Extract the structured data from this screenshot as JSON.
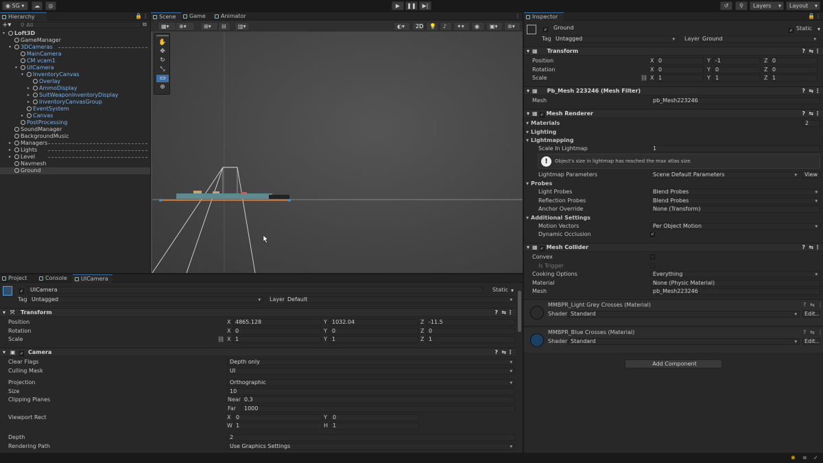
{
  "toolbar": {
    "account": "SG",
    "layers": "Layers",
    "layout": "Layout"
  },
  "hierarchy": {
    "tab": "Hierarchy",
    "search_placeholder": "All",
    "items": [
      {
        "label": "Loft3D",
        "depth": 0,
        "blue": false
      },
      {
        "label": "GameManager",
        "depth": 1,
        "blue": false
      },
      {
        "label": "3DCameras",
        "depth": 1,
        "blue": true
      },
      {
        "label": "MainCamera",
        "depth": 2,
        "blue": true
      },
      {
        "label": "CM vcam1",
        "depth": 2,
        "blue": true
      },
      {
        "label": "UICamera",
        "depth": 2,
        "blue": true
      },
      {
        "label": "InventoryCanvas",
        "depth": 3,
        "blue": true
      },
      {
        "label": "Overlay",
        "depth": 4,
        "blue": true
      },
      {
        "label": "AmmoDisplay",
        "depth": 4,
        "blue": true
      },
      {
        "label": "SuitWeaponInventoryDisplay",
        "depth": 4,
        "blue": true
      },
      {
        "label": "InventoryCanvasGroup",
        "depth": 4,
        "blue": true
      },
      {
        "label": "EventSystem",
        "depth": 3,
        "blue": true
      },
      {
        "label": "Canvas",
        "depth": 3,
        "blue": true
      },
      {
        "label": "PostProcessing",
        "depth": 2,
        "blue": true
      },
      {
        "label": "SoundManager",
        "depth": 1,
        "blue": false
      },
      {
        "label": "BackgroundMusic",
        "depth": 1,
        "blue": false
      },
      {
        "label": "Managers",
        "depth": 1,
        "blue": false
      },
      {
        "label": "Lights",
        "depth": 1,
        "blue": false
      },
      {
        "label": "Level",
        "depth": 1,
        "blue": false
      },
      {
        "label": "Navmesh",
        "depth": 1,
        "blue": false
      },
      {
        "label": "Ground",
        "depth": 1,
        "blue": false
      }
    ]
  },
  "scene": {
    "tabs": [
      "Scene",
      "Game",
      "Animator"
    ],
    "mode2d": "2D"
  },
  "bottom": {
    "tabs": [
      "Project",
      "Console",
      "UICamera"
    ],
    "object": {
      "name": "UICamera",
      "static": "Static",
      "tag_label": "Tag",
      "tag": "Untagged",
      "layer_label": "Layer",
      "layer": "Default"
    },
    "transform": {
      "title": "Transform",
      "position_label": "Position",
      "rotation_label": "Rotation",
      "scale_label": "Scale",
      "position": {
        "x": "4865.128",
        "y": "1032.04",
        "z": "-11.5"
      },
      "rotation": {
        "x": "0",
        "y": "0",
        "z": "0"
      },
      "scale": {
        "x": "1",
        "y": "1",
        "z": "1"
      }
    },
    "camera": {
      "title": "Camera",
      "clear_flags_label": "Clear Flags",
      "clear_flags": "Depth only",
      "culling_mask_label": "Culling Mask",
      "culling_mask": "UI",
      "projection_label": "Projection",
      "projection": "Orthographic",
      "size_label": "Size",
      "size": "10",
      "clipping_label": "Clipping Planes",
      "near_label": "Near",
      "near": "0.3",
      "far_label": "Far",
      "far": "1000",
      "viewport_label": "Viewport Rect",
      "vx": "0",
      "vy": "0",
      "vw": "1",
      "vh": "1",
      "depth_label": "Depth",
      "depth": "2",
      "rendering_path_label": "Rendering Path",
      "rendering_path": "Use Graphics Settings"
    }
  },
  "inspector": {
    "tab": "Inspector",
    "object": {
      "name": "Ground",
      "static": "Static",
      "tag_label": "Tag",
      "tag": "Untagged",
      "layer_label": "Layer",
      "layer": "Ground"
    },
    "transform": {
      "title": "Transform",
      "position_label": "Position",
      "rotation_label": "Rotation",
      "scale_label": "Scale",
      "position": {
        "x": "0",
        "y": "-1",
        "z": "0"
      },
      "rotation": {
        "x": "0",
        "y": "0",
        "z": "0"
      },
      "scale": {
        "x": "1",
        "y": "1",
        "z": "1"
      }
    },
    "mesh_filter": {
      "title": "Pb_Mesh 223246 (Mesh Filter)",
      "mesh_label": "Mesh",
      "mesh": "pb_Mesh223246"
    },
    "mesh_renderer": {
      "title": "Mesh Renderer",
      "materials_label": "Materials",
      "materials_count": "2",
      "lighting_label": "Lighting",
      "lightmapping_label": "Lightmapping",
      "scale_label": "Scale In Lightmap",
      "scale": "1",
      "warning": "Object's size in lightmap has reached the max atlas size.",
      "lightmap_params_label": "Lightmap Parameters",
      "lightmap_params": "Scene Default Parameters",
      "view_btn": "View",
      "probes_label": "Probes",
      "light_probes_label": "Light Probes",
      "light_probes": "Blend Probes",
      "reflection_probes_label": "Reflection Probes",
      "reflection_probes": "Blend Probes",
      "anchor_label": "Anchor Override",
      "anchor": "None (Transform)",
      "additional_label": "Additional Settings",
      "motion_label": "Motion Vectors",
      "motion": "Per Object Motion",
      "occlusion_label": "Dynamic Occlusion"
    },
    "mesh_collider": {
      "title": "Mesh Collider",
      "convex_label": "Convex",
      "trigger_label": "Is Trigger",
      "cooking_label": "Cooking Options",
      "cooking": "Everything",
      "material_label": "Material",
      "material": "None (Physic Material)",
      "mesh_label": "Mesh",
      "mesh": "pb_Mesh223246"
    },
    "materials": [
      {
        "title": "MMBPR_Light Grey Crosses (Material)",
        "shader_label": "Shader",
        "shader": "Standard",
        "edit": "Edit...",
        "color": "#2b2b2b"
      },
      {
        "title": "MMBPR_Blue Crosses (Material)",
        "shader_label": "Shader",
        "shader": "Standard",
        "edit": "Edit...",
        "color": "#1c3f66"
      }
    ],
    "add_component": "Add Component"
  },
  "axes": {
    "x": "X",
    "y": "Y",
    "z": "Z",
    "w": "W",
    "h": "H"
  }
}
